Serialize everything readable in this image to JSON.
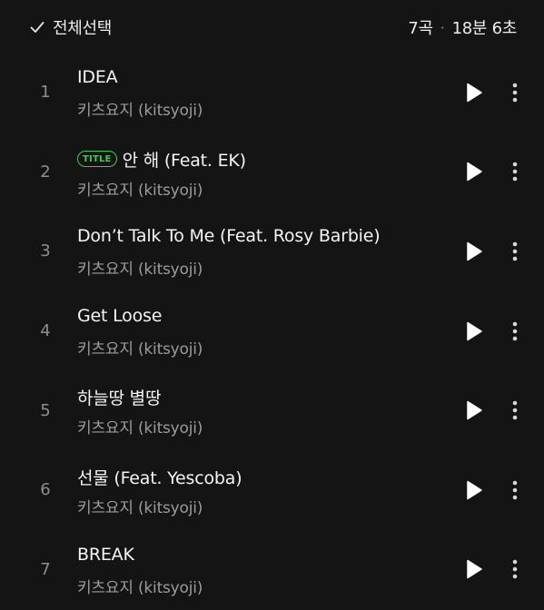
{
  "header": {
    "select_all_label": "전체선택",
    "track_count": "7곡",
    "separator": "·",
    "total_duration": "18분 6초",
    "check_icon": "check-icon"
  },
  "colors": {
    "background": "#141414",
    "title_badge": "#3ccf4e",
    "primary_text": "#f4f4f4",
    "secondary_text": "#9b9b9b"
  },
  "tracks": [
    {
      "number": "1",
      "title": "IDEA",
      "badge": "",
      "artist": "키츠요지 (kitsyoji)"
    },
    {
      "number": "2",
      "title": "안 해 (Feat. EK)",
      "badge": "TITLE",
      "artist": "키츠요지 (kitsyoji)"
    },
    {
      "number": "3",
      "title": "Don’t Talk To Me (Feat. Rosy Barbie)",
      "badge": "",
      "artist": "키츠요지 (kitsyoji)"
    },
    {
      "number": "4",
      "title": "Get Loose",
      "badge": "",
      "artist": "키츠요지 (kitsyoji)"
    },
    {
      "number": "5",
      "title": "하늘땅 별땅",
      "badge": "",
      "artist": "키츠요지 (kitsyoji)"
    },
    {
      "number": "6",
      "title": "선물 (Feat. Yescoba)",
      "badge": "",
      "artist": "키츠요지 (kitsyoji)"
    },
    {
      "number": "7",
      "title": "BREAK",
      "badge": "",
      "artist": "키츠요지 (kitsyoji)"
    }
  ],
  "icons": {
    "play": "play-icon",
    "more": "more-vertical-icon"
  }
}
